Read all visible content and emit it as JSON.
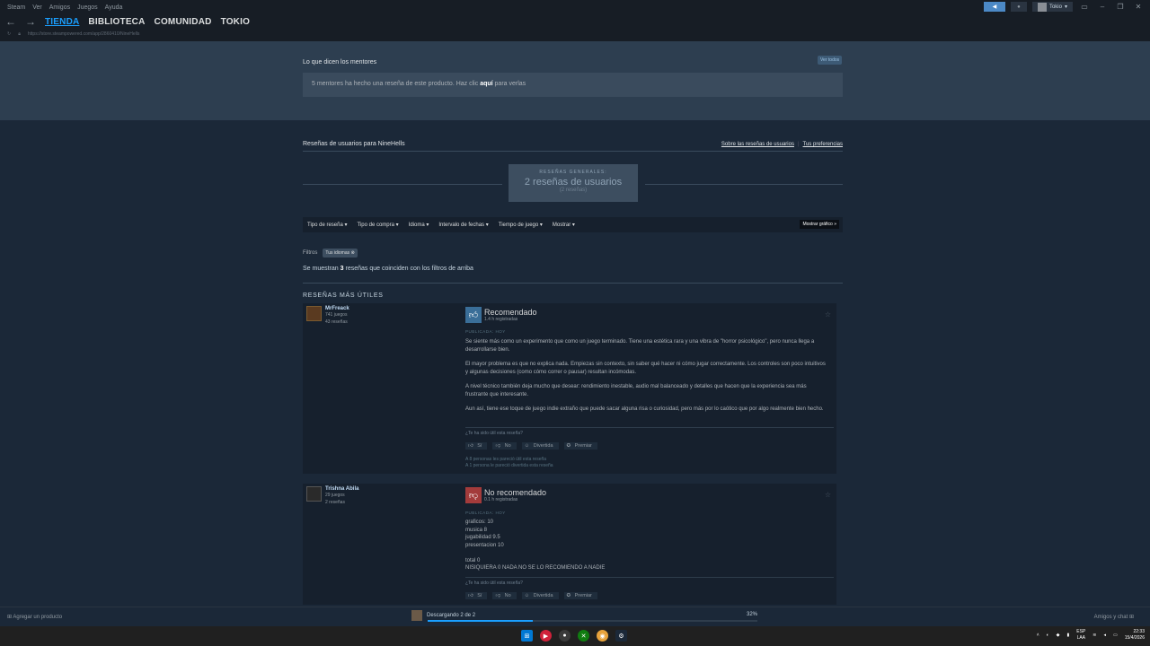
{
  "titlebar": {
    "app": "Steam",
    "menu": [
      "Ver",
      "Amigos",
      "Juegos",
      "Ayuda"
    ],
    "user": "Tokio"
  },
  "nav": {
    "tabs": [
      "TIENDA",
      "BIBLIOTECA",
      "COMUNIDAD",
      "TOKIO"
    ],
    "url": "https://store.steampowered.com/app/2860410/NineHells"
  },
  "mentors": {
    "title": "Lo que dicen los mentores",
    "view_all": "Ver todos",
    "text_before": "5 mentores ha hecho una reseña de este producto. Haz clic",
    "link": "aquí",
    "text_after": "para verlas"
  },
  "reviews": {
    "title": "Reseñas de usuarios para NineHells",
    "link_about": "Sobre las reseñas de usuarios",
    "link_prefs": "Tus preferencias",
    "summary_label": "RESEÑAS GENERALES:",
    "summary_value": "2 reseñas de usuarios",
    "summary_sub": "(2 reseñas)",
    "filters": [
      "Tipo de reseña",
      "Tipo de compra",
      "Idioma",
      "Intervalo de fechas",
      "Tiempo de juego",
      "Mostrar"
    ],
    "graph_button": "Mostrar gráfico",
    "filters_label": "Filtros",
    "filter_chip": "Tus idiomas",
    "showing_before": "Se muestran",
    "showing_count": "3",
    "showing_after": "reseñas que coinciden con los filtros de arriba",
    "helpful_title": "RESEÑAS MÁS ÚTILES"
  },
  "review1": {
    "author": "MrFreack",
    "games": "741 juegos",
    "reviews": "43 reseñas",
    "verdict": "Recomendado",
    "hours": "1.4 h registradas",
    "posted": "PUBLICADA: HOY",
    "p1": "Se siente más como un experimento que como un juego terminado. Tiene una estética rara y una vibra de \"horror psicológico\", pero nunca llega a desarrollarse bien.",
    "p2": "El mayor problema es que no explica nada. Empiezas sin contexto, sin saber qué hacer ni cómo jugar correctamente. Los controles son poco intuitivos y algunas decisiones (como cómo correr o pausar) resultan incómodas.",
    "p3": "A nivel técnico también deja mucho que desear: rendimiento inestable, audio mal balanceado y detalles que hacen que la experiencia sea más frustrante que interesante.",
    "p4": "Aun así, tiene ese toque de juego indie extraño que puede sacar alguna risa o curiosidad, pero más por lo caótico que por algo realmente bien hecho.",
    "help_q": "¿Te ha sido útil esta reseña?",
    "votes": [
      "Sí",
      "No",
      "Divertida",
      "Premiar"
    ],
    "foot1": "A 8 personas les pareció útil esta reseña",
    "foot2": "A 1 persona le pareció divertida esta reseña"
  },
  "review2": {
    "author": "Trishna Abila",
    "games": "29 juegos",
    "reviews": "2 reseñas",
    "verdict": "No recomendado",
    "hours": "0.1 h registradas",
    "posted": "PUBLICADA: HOY",
    "lines": [
      "graficos: 10",
      "musica 8",
      "jugabilidad 9.5",
      "presentacion 10",
      "",
      "total 0",
      "NISIQUIERA 0 NADA NO SE LO RECOMIENDO A NADIE"
    ],
    "help_q": "¿Te ha sido útil esta reseña?",
    "votes": [
      "Sí",
      "No",
      "Divertida",
      "Premiar"
    ]
  },
  "bottombar": {
    "add_product": "Agregar un producto",
    "download": "Descargando 2 de 2",
    "progress_pct": "32%",
    "progress": 0.32,
    "friends": "Amigos y chat"
  },
  "tray": {
    "lang1": "ESP",
    "lang2": "LAA",
    "time": "22:33",
    "date": "15/4/2026"
  },
  "colors": {
    "accent": "#1a9fff",
    "background": "#1b2838",
    "positive": "#3a6e98",
    "negative": "#a33b3b"
  }
}
